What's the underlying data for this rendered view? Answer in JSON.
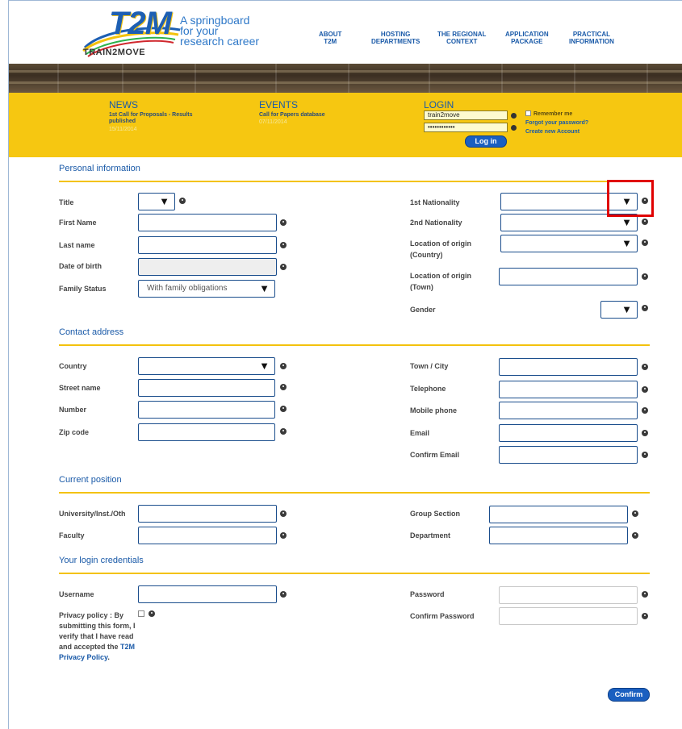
{
  "header": {
    "logo_text": "T2M",
    "logo_sub": "TRAIN2MOVE",
    "tagline": [
      "A springboard",
      "for your",
      "research career"
    ],
    "nav": [
      {
        "lines": [
          "ABOUT",
          "T2M"
        ]
      },
      {
        "lines": [
          "HOSTING",
          "DEPARTMENTS"
        ]
      },
      {
        "lines": [
          "THE REGIONAL",
          "CONTEXT"
        ]
      },
      {
        "lines": [
          "APPLICATION",
          "PACKAGE"
        ]
      },
      {
        "lines": [
          "PRACTICAL",
          "INFORMATION"
        ]
      }
    ]
  },
  "news": {
    "heading": "NEWS",
    "text": [
      "1st Call for Proposals - Results",
      "published"
    ],
    "date": "15/11/2014"
  },
  "events": {
    "heading": "EVENTS",
    "text": "Call for Papers database",
    "date": "07/11/2014"
  },
  "login": {
    "heading": "LOGIN",
    "username_value": "train2move",
    "password_value": "••••••••••••",
    "button_label": "Log in",
    "remember_label": "Remember me",
    "forgot_link": "Forgot your password?",
    "create_link": "Create new Account"
  },
  "sections": {
    "personal": "Personal information",
    "contact": "Contact address",
    "position": "Current position",
    "credentials": "Your login credentials"
  },
  "personal": {
    "title": "Title",
    "first_name": "First Name",
    "last_name": "Last name",
    "dob": "Date of birth",
    "family_status": "Family Status",
    "family_status_value": "With family obligations",
    "nationality1": "1st Nationality",
    "nationality2": "2nd Nationality",
    "origin_country": [
      "Location of origin",
      "(Country)"
    ],
    "origin_town": [
      "Location of origin",
      "(Town)"
    ],
    "gender": "Gender"
  },
  "contact": {
    "country": "Country",
    "street": "Street name",
    "number": "Number",
    "zip": "Zip code",
    "town": "Town / City",
    "telephone": "Telephone",
    "mobile": "Mobile phone",
    "email": "Email",
    "confirm_email": "Confirm Email"
  },
  "position": {
    "university": "University/Inst./Oth",
    "faculty": "Faculty",
    "group": "Group Section",
    "department": "Department"
  },
  "credentials": {
    "username": "Username",
    "password": "Password",
    "confirm_password": "Confirm Password",
    "privacy_text": "Privacy policy : By submitting this form, I verify that I have read and accepted the ",
    "privacy_link": "T2M Privacy Policy",
    "privacy_end": "."
  },
  "confirm_label": "Confirm",
  "dropdown_arrow": "▼",
  "colors": {
    "brand_blue": "#1a5aa8",
    "brand_yellow": "#f6c711",
    "highlight_red": "#e00000"
  }
}
